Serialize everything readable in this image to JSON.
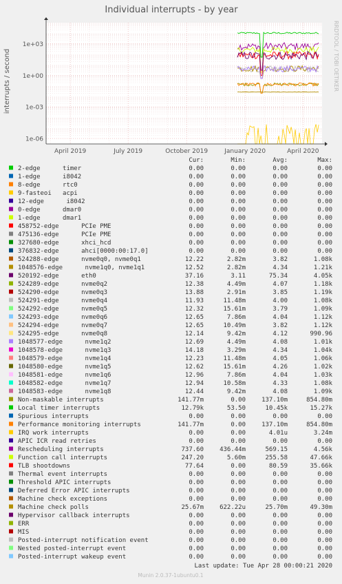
{
  "chart_data": {
    "type": "line",
    "title": "Individual interrupts - by year",
    "ylabel": "interrupts / second",
    "side_label": "RRDTOOL / TOBI OETIKER",
    "yscale": "log",
    "ylim": [
      3e-07,
      100000.0
    ],
    "y_ticks": [
      {
        "value": 1000,
        "label": "1e+03"
      },
      {
        "value": 1,
        "label": "1e+00"
      },
      {
        "value": 0.001,
        "label": "1e-03"
      },
      {
        "value": 1e-06,
        "label": "1e-06"
      }
    ],
    "xlim": [
      "2019-02-22",
      "2020-05-01"
    ],
    "data_start": "2019-12-20",
    "x_ticks": [
      {
        "date": "2019-04-01",
        "label": "April 2019"
      },
      {
        "date": "2019-07-01",
        "label": "July 2019"
      },
      {
        "date": "2019-10-01",
        "label": "October 2019"
      },
      {
        "date": "2020-01-01",
        "label": "January 2020"
      },
      {
        "date": "2020-04-01",
        "label": "April 2020"
      }
    ],
    "grid": true,
    "legend_header": {
      "cur": "Cur:",
      "min": "Min:",
      "avg": "Avg:",
      "max": "Max:"
    },
    "series": [
      {
        "name": "2-edge      timer",
        "color": "#00cc00",
        "cur": "0.00",
        "min": "0.00",
        "avg": "0.00",
        "max": "0.00"
      },
      {
        "name": "1-edge      i8042",
        "color": "#0066b3",
        "cur": "0.00",
        "min": "0.00",
        "avg": "0.00",
        "max": "0.00"
      },
      {
        "name": "8-edge      rtc0",
        "color": "#ff8000",
        "cur": "0.00",
        "min": "0.00",
        "avg": "0.00",
        "max": "0.00"
      },
      {
        "name": "9-fasteoi   acpi",
        "color": "#ffcc00",
        "cur": "0.00",
        "min": "0.00",
        "avg": "0.00",
        "max": "0.00"
      },
      {
        "name": "12-edge      i8042",
        "color": "#330099",
        "cur": "0.00",
        "min": "0.00",
        "avg": "0.00",
        "max": "0.00"
      },
      {
        "name": "0-edge      dmar0",
        "color": "#990099",
        "cur": "0.00",
        "min": "0.00",
        "avg": "0.00",
        "max": "0.00"
      },
      {
        "name": "1-edge      dmar1",
        "color": "#ccff00",
        "cur": "0.00",
        "min": "0.00",
        "avg": "0.00",
        "max": "0.00"
      },
      {
        "name": "458752-edge      PCIe PME",
        "color": "#ff0000",
        "cur": "0.00",
        "min": "0.00",
        "avg": "0.00",
        "max": "0.00"
      },
      {
        "name": "475136-edge      PCIe PME",
        "color": "#808080",
        "cur": "0.00",
        "min": "0.00",
        "avg": "0.00",
        "max": "0.00"
      },
      {
        "name": "327680-edge      xhci_hcd",
        "color": "#008f00",
        "cur": "0.00",
        "min": "0.00",
        "avg": "0.00",
        "max": "0.00"
      },
      {
        "name": "376832-edge      ahci[0000:00:17.0]",
        "color": "#00487d",
        "cur": "0.00",
        "min": "0.00",
        "avg": "0.00",
        "max": "0.00"
      },
      {
        "name": "524288-edge      nvme0q0, nvme0q1",
        "color": "#b35a00",
        "cur": "12.22",
        "min": "2.82m",
        "avg": "3.82",
        "max": "1.08k"
      },
      {
        "name": "1048576-edge      nvme1q0, nvme1q1",
        "color": "#b38f00",
        "cur": "12.52",
        "min": "2.82m",
        "avg": "4.34",
        "max": "1.21k"
      },
      {
        "name": "520192-edge      eth0",
        "color": "#6b006b",
        "cur": "37.16",
        "min": "3.11",
        "avg": "75.34",
        "max": "4.05k"
      },
      {
        "name": "524289-edge      nvme0q2",
        "color": "#8fb300",
        "cur": "12.38",
        "min": "4.49m",
        "avg": "4.07",
        "max": "1.18k"
      },
      {
        "name": "524290-edge      nvme0q3",
        "color": "#b30000",
        "cur": "13.88",
        "min": "2.91m",
        "avg": "3.85",
        "max": "1.19k"
      },
      {
        "name": "524291-edge      nvme0q4",
        "color": "#bebebe",
        "cur": "11.93",
        "min": "11.48m",
        "avg": "4.00",
        "max": "1.08k"
      },
      {
        "name": "524292-edge      nvme0q5",
        "color": "#80ff80",
        "cur": "12.32",
        "min": "15.61m",
        "avg": "3.79",
        "max": "1.09k"
      },
      {
        "name": "524293-edge      nvme0q6",
        "color": "#80c9ff",
        "cur": "12.65",
        "min": "7.86m",
        "avg": "4.04",
        "max": "1.12k"
      },
      {
        "name": "524294-edge      nvme0q7",
        "color": "#ffc080",
        "cur": "12.65",
        "min": "10.49m",
        "avg": "3.82",
        "max": "1.12k"
      },
      {
        "name": "524295-edge      nvme0q8",
        "color": "#ffe680",
        "cur": "12.14",
        "min": "9.42m",
        "avg": "4.12",
        "max": "990.96"
      },
      {
        "name": "1048577-edge      nvme1q2",
        "color": "#aa80ff",
        "cur": "12.69",
        "min": "4.49m",
        "avg": "4.08",
        "max": "1.01k"
      },
      {
        "name": "1048578-edge      nvme1q3",
        "color": "#ee00cc",
        "cur": "14.18",
        "min": "3.29m",
        "avg": "4.34",
        "max": "1.04k"
      },
      {
        "name": "1048579-edge      nvme1q4",
        "color": "#ff8080",
        "cur": "12.23",
        "min": "11.48m",
        "avg": "4.05",
        "max": "1.06k"
      },
      {
        "name": "1048580-edge      nvme1q5",
        "color": "#666600",
        "cur": "12.62",
        "min": "15.61m",
        "avg": "4.26",
        "max": "1.02k"
      },
      {
        "name": "1048581-edge      nvme1q6",
        "color": "#ffbfff",
        "cur": "12.96",
        "min": "7.86m",
        "avg": "4.04",
        "max": "1.03k"
      },
      {
        "name": "1048582-edge      nvme1q7",
        "color": "#00ffcc",
        "cur": "12.94",
        "min": "10.58m",
        "avg": "4.33",
        "max": "1.08k"
      },
      {
        "name": "1048583-edge      nvme1q8",
        "color": "#cc6699",
        "cur": "12.44",
        "min": "9.42m",
        "avg": "4.08",
        "max": "1.09k"
      },
      {
        "name": "Non-maskable interrupts",
        "color": "#999900",
        "cur": "141.77m",
        "min": "0.00",
        "avg": "137.10m",
        "max": "854.80m"
      },
      {
        "name": "Local timer interrupts",
        "color": "#00cc00",
        "cur": "12.79k",
        "min": "53.50",
        "avg": "10.45k",
        "max": "15.27k"
      },
      {
        "name": "Spurious interrupts",
        "color": "#0066b3",
        "cur": "0.00",
        "min": "0.00",
        "avg": "0.00",
        "max": "0.00"
      },
      {
        "name": "Performance monitoring interrupts",
        "color": "#ff8000",
        "cur": "141.77m",
        "min": "0.00",
        "avg": "137.10m",
        "max": "854.80m"
      },
      {
        "name": "IRQ work interrupts",
        "color": "#ffcc00",
        "cur": "0.00",
        "min": "0.00",
        "avg": "4.01u",
        "max": "3.24m"
      },
      {
        "name": "APIC ICR read retries",
        "color": "#330099",
        "cur": "0.00",
        "min": "0.00",
        "avg": "0.00",
        "max": "0.00"
      },
      {
        "name": "Rescheduling interrupts",
        "color": "#990099",
        "cur": "737.60",
        "min": "436.44m",
        "avg": "569.15",
        "max": "4.56k"
      },
      {
        "name": "Function call interrupts",
        "color": "#ccff00",
        "cur": "247.20",
        "min": "5.60m",
        "avg": "255.58",
        "max": "47.66k"
      },
      {
        "name": "TLB shootdowns",
        "color": "#ff0000",
        "cur": "77.64",
        "min": "0.00",
        "avg": "80.59",
        "max": "35.66k"
      },
      {
        "name": "Thermal event interrupts",
        "color": "#808080",
        "cur": "0.00",
        "min": "0.00",
        "avg": "0.00",
        "max": "0.00"
      },
      {
        "name": "Threshold APIC interrupts",
        "color": "#008f00",
        "cur": "0.00",
        "min": "0.00",
        "avg": "0.00",
        "max": "0.00"
      },
      {
        "name": "Deferred Error APIC interrupts",
        "color": "#00487d",
        "cur": "0.00",
        "min": "0.00",
        "avg": "0.00",
        "max": "0.00"
      },
      {
        "name": "Machine check exceptions",
        "color": "#b35a00",
        "cur": "0.00",
        "min": "0.00",
        "avg": "0.00",
        "max": "0.00"
      },
      {
        "name": "Machine check polls",
        "color": "#b38f00",
        "cur": "25.67m",
        "min": "622.22u",
        "avg": "25.70m",
        "max": "49.30m"
      },
      {
        "name": "Hypervisor callback interrupts",
        "color": "#6b006b",
        "cur": "0.00",
        "min": "0.00",
        "avg": "0.00",
        "max": "0.00"
      },
      {
        "name": "ERR",
        "color": "#8fb300",
        "cur": "0.00",
        "min": "0.00",
        "avg": "0.00",
        "max": "0.00"
      },
      {
        "name": "MIS",
        "color": "#b30000",
        "cur": "0.00",
        "min": "0.00",
        "avg": "0.00",
        "max": "0.00"
      },
      {
        "name": "Posted-interrupt notification event",
        "color": "#bebebe",
        "cur": "0.00",
        "min": "0.00",
        "avg": "0.00",
        "max": "0.00"
      },
      {
        "name": "Nested posted-interrupt event",
        "color": "#80ff80",
        "cur": "0.00",
        "min": "0.00",
        "avg": "0.00",
        "max": "0.00"
      },
      {
        "name": "Posted-interrupt wakeup event",
        "color": "#80c9ff",
        "cur": "0.00",
        "min": "0.00",
        "avg": "0.00",
        "max": "0.00"
      }
    ],
    "plotted": [
      {
        "ref": "Local timer interrupts",
        "color": "#00cc00",
        "level": 10450,
        "spread": 0.08,
        "dip": 53.5
      },
      {
        "ref": "Rescheduling interrupts",
        "color": "#990099",
        "level": 569,
        "spread": 0.35,
        "dip": 3
      },
      {
        "ref": "Function call interrupts",
        "color": "#ccff00",
        "level": 256,
        "spread": 0.3,
        "dip": 2
      },
      {
        "ref": "TLB shootdowns",
        "color": "#ff0000",
        "level": 80.6,
        "spread": 0.35,
        "dip": 1
      },
      {
        "ref": "520192-edge      eth0",
        "color": "#6b006b",
        "level": 75,
        "spread": 0.4,
        "dip": 3
      },
      {
        "ref": "524291-edge      nvme0q4",
        "color": "#bebebe",
        "level": 4,
        "spread": 0.3,
        "dip": 0.5
      },
      {
        "ref": "1048576-edge      nvme1q0, nvme1q1",
        "color": "#b38f00",
        "level": 4.3,
        "spread": 0.3,
        "dip": 0.5
      },
      {
        "ref": "1048577-edge      nvme1q2",
        "color": "#aa80ff",
        "level": 4.1,
        "spread": 0.3,
        "dip": 0.5
      },
      {
        "ref": "Non-maskable interrupts",
        "color": "#999900",
        "level": 0.137,
        "spread": 0.15,
        "dip": 0.02
      },
      {
        "ref": "Performance monitoring interrupts",
        "color": "#ff8000",
        "level": 0.137,
        "spread": 0.15,
        "dip": 0.02
      },
      {
        "ref": "Machine check polls",
        "color": "#b38f00",
        "level": 0.0257,
        "spread": 0.02,
        "dip": 0.0257
      },
      {
        "ref": "IRQ work interrupts",
        "color": "#ffcc00",
        "level": 4e-06,
        "spread": 0.6,
        "dip": 1e-06,
        "sparse": true
      }
    ]
  },
  "footer": {
    "last_update": "Last update: Tue Apr 28 00:00:21 2020",
    "version": "Munin 2.0.37-1ubuntu0.1"
  }
}
